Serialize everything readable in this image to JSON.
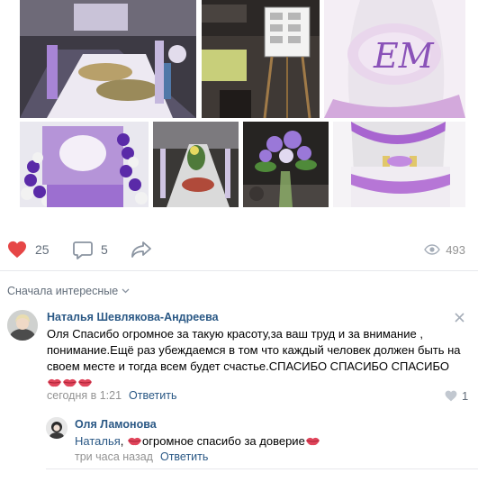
{
  "post": {
    "photos": [
      {
        "name": "photo-banquet-hall",
        "kind": "banquet"
      },
      {
        "name": "photo-seating-board",
        "kind": "seating"
      },
      {
        "name": "photo-monogram-backdrop",
        "kind": "monogram"
      },
      {
        "name": "photo-balloon-wall",
        "kind": "balloons"
      },
      {
        "name": "photo-table-setting",
        "kind": "table"
      },
      {
        "name": "photo-flower-bouquet",
        "kind": "flowers"
      },
      {
        "name": "photo-presidium-table",
        "kind": "presidium"
      }
    ],
    "actions": {
      "likes": "25",
      "comments": "5",
      "views": "493"
    },
    "colors": {
      "like_red": "#e64646",
      "link_blue": "#2a5885",
      "muted": "#939393",
      "accent_purple": "#8b4fc4"
    }
  },
  "comments": {
    "sort_label": "Сначала интересные",
    "items": [
      {
        "author": "Наталья Шевлякова-Андреева",
        "text": "Оля Спасибо огромное за такую красоту,за ваш труд и за внимание , понимание.Ещё раз убеждаемся в том что каждый человек должен быть на своем месте и тогда всем будет счастье.СПАСИБО СПАСИБО СПАСИБО",
        "time": "сегодня в 1:21",
        "reply_label": "Ответить",
        "likes": "1",
        "reply": {
          "author": "Оля Ламонова",
          "mention": "Наталья",
          "mention_sep": ",",
          "text": "огромное спасибо за доверие",
          "time": "три часа назад",
          "reply_label": "Ответить"
        }
      }
    ]
  },
  "icons": {
    "like": "heart-icon",
    "comment": "speech-bubble-icon",
    "share": "share-arrow-icon",
    "views": "eye-icon",
    "sort": "chevron-down-icon",
    "close": "close-icon",
    "emoji": "kiss-mark-emoji"
  }
}
